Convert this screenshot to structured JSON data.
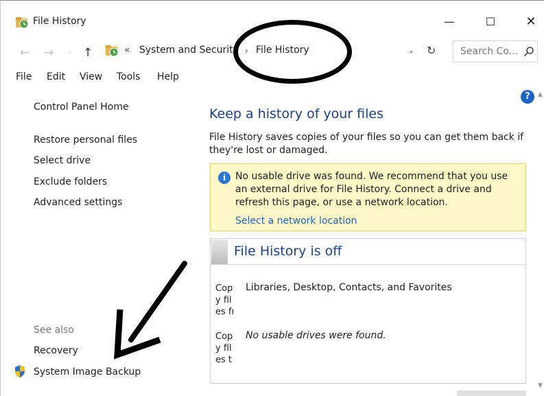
{
  "window": {
    "title": "File History",
    "minimize": "—",
    "maximize": "☐",
    "close": "✕"
  },
  "address": {
    "back": "←",
    "forward": "→",
    "recent": "⌄",
    "up": "↑",
    "separator": "«",
    "crumb1": "System and Security",
    "crumb_arrow": "›",
    "crumb2": "File History",
    "dropdown": "⌄",
    "refresh": "↻",
    "search_placeholder": "Search Co..."
  },
  "menu": [
    "File",
    "Edit",
    "View",
    "Tools",
    "Help"
  ],
  "left_pane": {
    "home": "Control Panel Home",
    "links": [
      "Restore personal files",
      "Select drive",
      "Exclude folders",
      "Advanced settings"
    ],
    "see_also": "See also",
    "see_also_links": [
      "Recovery",
      "System Image Backup"
    ]
  },
  "main": {
    "help": "?",
    "title": "Keep a history of your files",
    "description": "File History saves copies of your files so you can get them back if they're lost or damaged.",
    "info": {
      "icon": "i",
      "text": "No usable drive was found. We recommend that you use an external drive for File History. Connect a drive and refresh this page, or use a network location.",
      "link": "Select a network location"
    },
    "status_panel": {
      "title": "File History is off",
      "row1_label": "Copy files from:",
      "row1_value": "Libraries, Desktop, Contacts, and Favorites",
      "row2_label": "Copy files to:",
      "row2_value": "No usable drives were found."
    }
  },
  "colors": {
    "link_blue": "#1a64c8",
    "title_blue": "#1c3f94",
    "info_bg": "#fdf8c6"
  }
}
